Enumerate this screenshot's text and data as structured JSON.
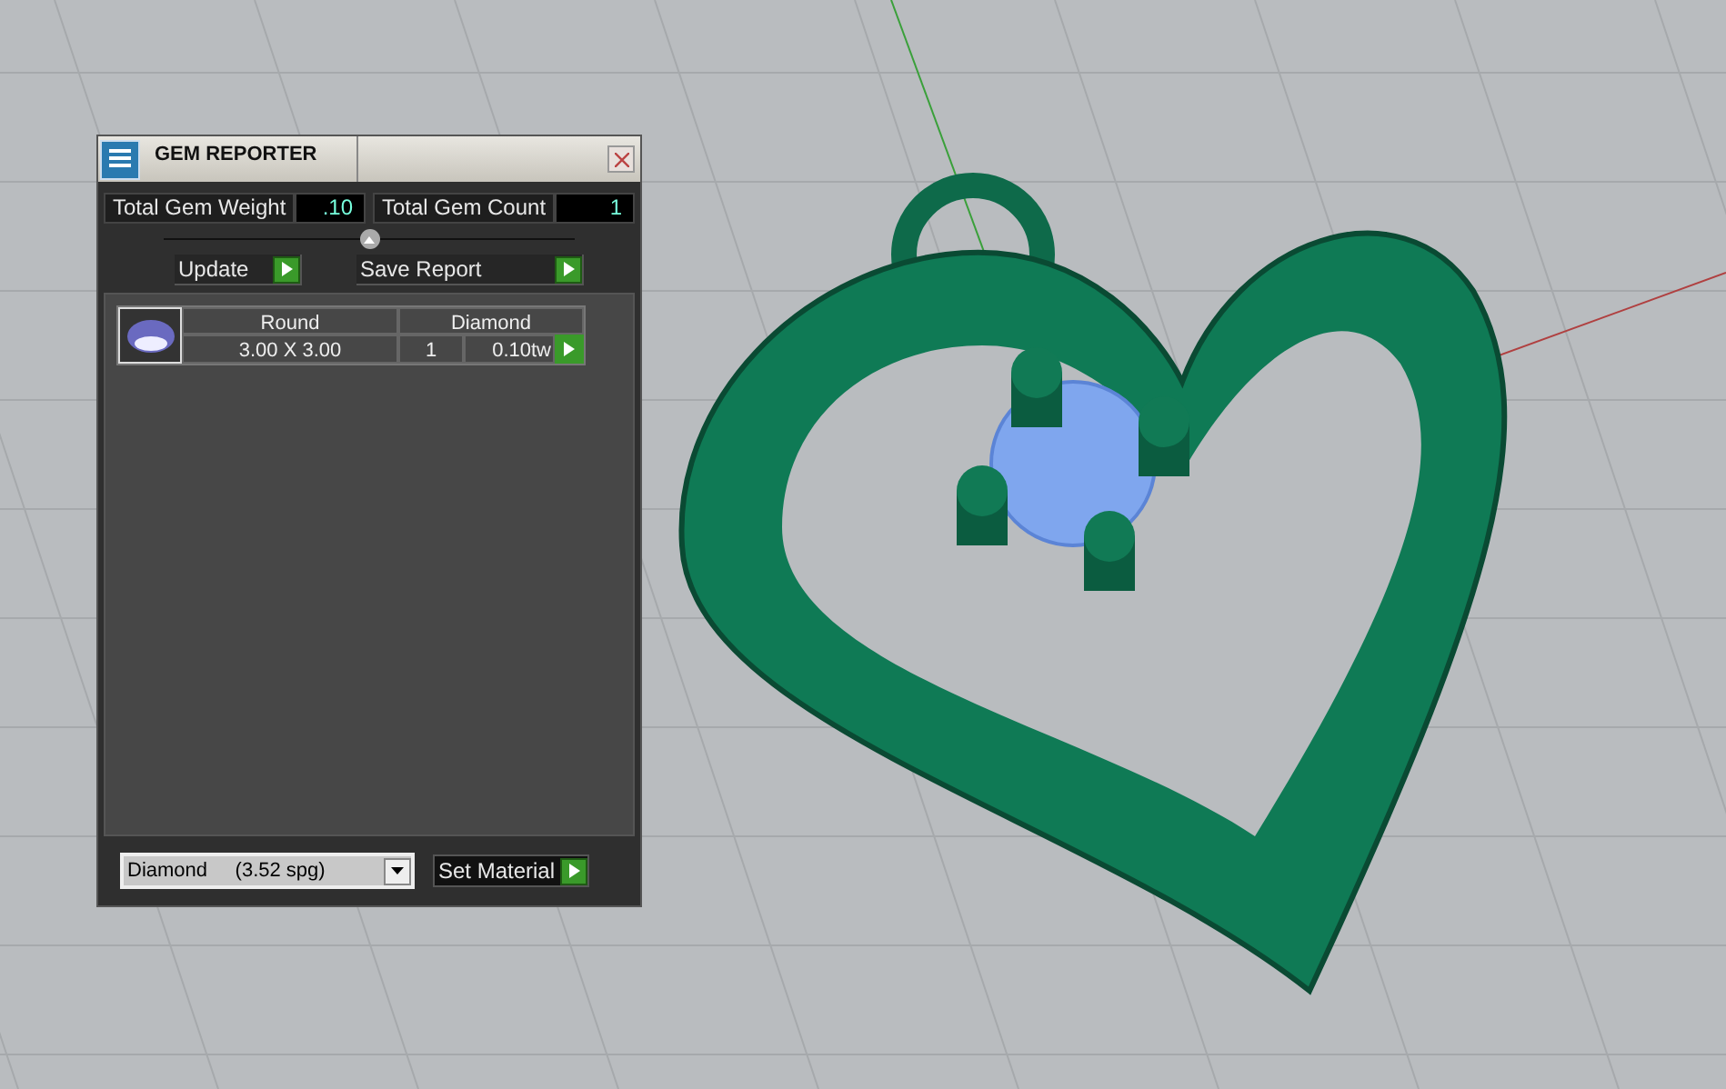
{
  "window": {
    "title": "GEM REPORTER"
  },
  "totals": [
    {
      "label": "Total Gem Weight",
      "value": ".10"
    },
    {
      "label": "Total Gem Count",
      "value": "1"
    }
  ],
  "actions": [
    {
      "label": "Update"
    },
    {
      "label": "Save Report"
    }
  ],
  "gems": [
    {
      "shape": "Round",
      "size": "3.00 X 3.00",
      "material": "Diamond",
      "count": "1",
      "weight": "0.10tw"
    }
  ],
  "material_select": {
    "value": "Diamond     (3.52 spg)"
  },
  "set_button": {
    "label": "Set Material"
  }
}
